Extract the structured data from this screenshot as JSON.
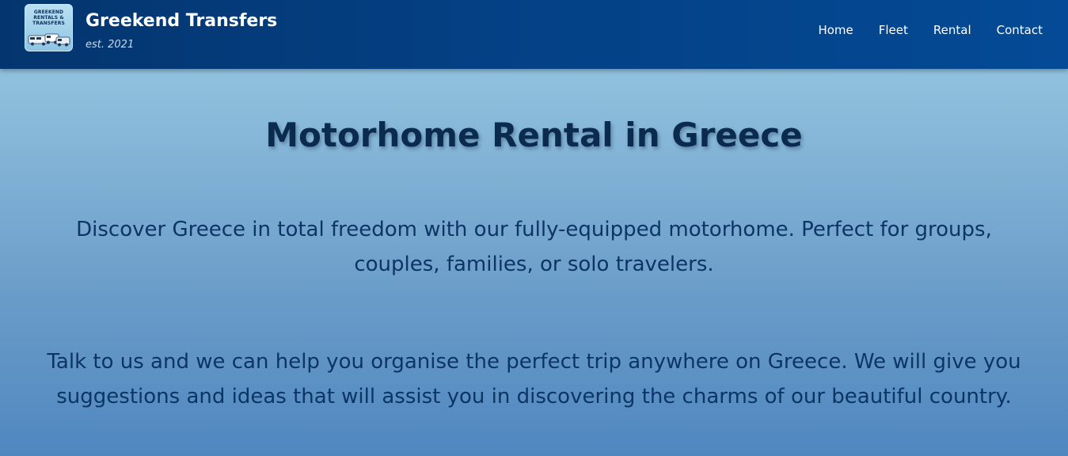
{
  "header": {
    "logo": {
      "line1": "GREEKEND",
      "line2": "RENTALS &",
      "line3": "TRANSFERS",
      "icon": "vans-logo-icon"
    },
    "brand_title": "Greekend Transfers",
    "brand_subtitle": "est. 2021",
    "nav": [
      "Home",
      "Fleet",
      "Rental",
      "Contact"
    ]
  },
  "main": {
    "headline": "Motorhome Rental in Greece",
    "paragraph1": "Discover Greece in total freedom with our fully-equipped motorhome. Perfect for groups, couples, families, or solo travelers.",
    "paragraph2": "Talk to us and we can help you organise the perfect trip anywhere on Greece. We will give you suggestions and ideas that will assist you in discovering the charms of our beautiful country."
  },
  "colors": {
    "header_bg": "#04408a",
    "headline": "#0a2a4e",
    "body_text": "#0c3566",
    "nav_text": "#ffffff"
  }
}
